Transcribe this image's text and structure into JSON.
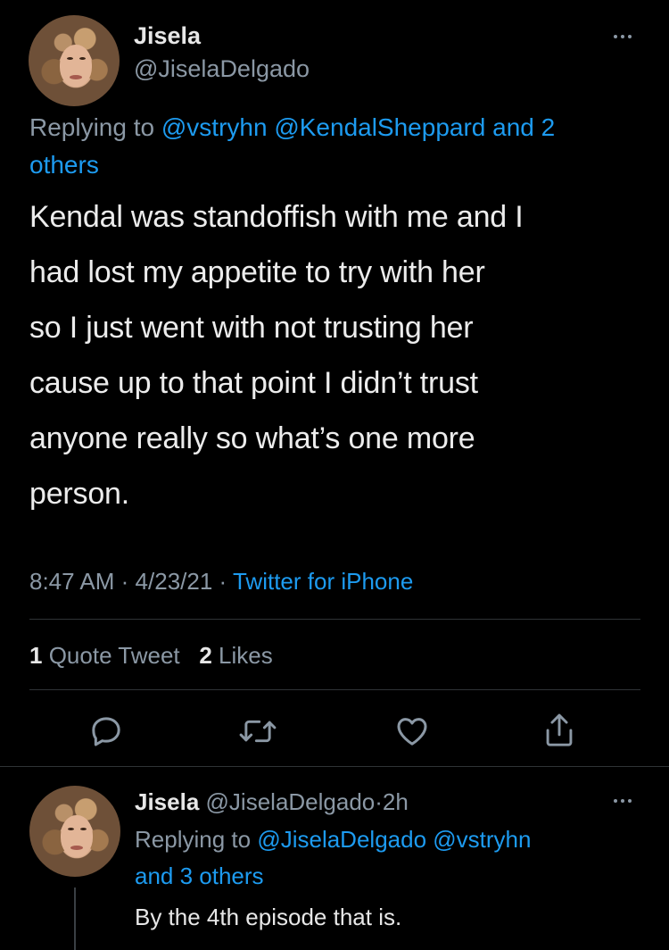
{
  "main_tweet": {
    "display_name": "Jisela",
    "handle": "@JiselaDelgado",
    "replying_prefix": "Replying to",
    "replying_mentions": "@vstryhn @KendalSheppard and 2",
    "replying_others": "others",
    "body_lines": [
      "Kendal was standoffish with me and I",
      "had lost my appetite to try with her",
      "so I just went with not trusting her",
      "cause up to that point I didn’t trust",
      "anyone really so what’s one more",
      "person."
    ],
    "time": "8:47 AM",
    "date": "4/23/21",
    "source": "Twitter for iPhone",
    "separator": "·",
    "quote_count": "1",
    "quote_label": "Quote Tweet",
    "like_count": "2",
    "like_label": "Likes",
    "actions": [
      "reply-icon",
      "retweet-icon",
      "like-icon",
      "share-icon"
    ]
  },
  "reply_tweet": {
    "display_name": "Jisela",
    "handle": "@JiselaDelgado",
    "separator": "·",
    "age": "2h",
    "replying_prefix": "Replying to",
    "replying_mentions": "@JiselaDelgado @vstryhn",
    "replying_others": "and 3 others",
    "body": "By the 4th episode that is."
  },
  "colors": {
    "background": "#000000",
    "link": "#1d9bf0",
    "muted": "#8b98a5",
    "divider": "#2f3336"
  }
}
